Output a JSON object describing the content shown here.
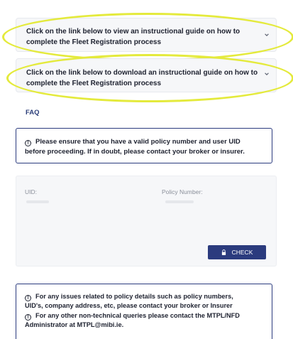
{
  "accordions": [
    {
      "line1": "Click on the link below to view an instructional guide on how to",
      "line2": "complete the Fleet Registration process"
    },
    {
      "line1": "Click on the link below to download an instructional guide on how to",
      "line2": "complete the Fleet Registration process"
    }
  ],
  "faq_label": "FAQ",
  "policy_notice": {
    "line1": "Please ensure that you have a valid policy number and user UID",
    "line2": "before proceeding. If in doubt, please contact your broker or insurer."
  },
  "form": {
    "uid_label": "UID:",
    "policy_label": "Policy Number:",
    "check_label": "CHECK"
  },
  "help_notice": {
    "line1": "For any issues related to policy details such as policy numbers,",
    "line2": "UID's, company address, etc, please contact your broker or Insurer",
    "line3": "For any other non-technical queries please contact the MTPL/NFD",
    "line4": "Administrator at MTPL@mibi.ie."
  },
  "colors": {
    "primary": "#2b3b7e",
    "highlight": "#e4ea3c",
    "card": "#f6f7f9"
  },
  "icons": [
    "chevron-down-icon",
    "info-icon",
    "lock-icon"
  ]
}
